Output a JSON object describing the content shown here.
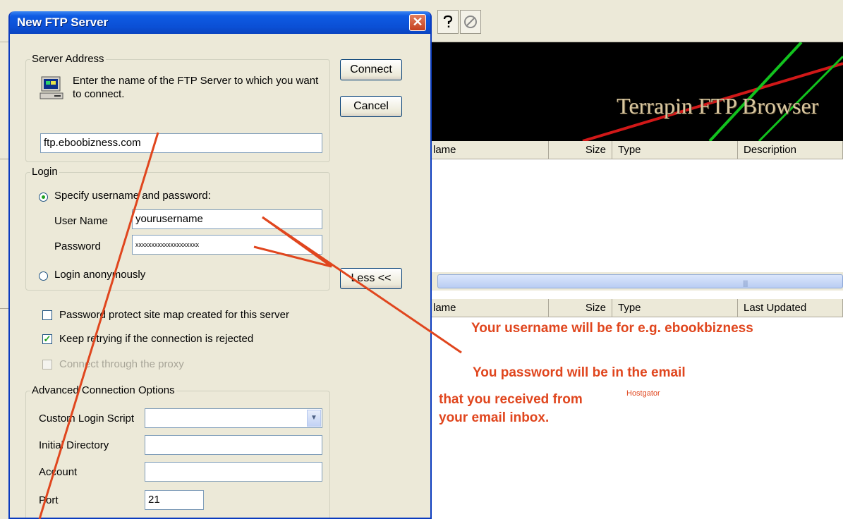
{
  "background_app": {
    "toolbar_icons": [
      "help-question-icon",
      "stop-icon"
    ],
    "banner_title": "Terrapin FTP Browser",
    "remote_list_columns": [
      "lame",
      "Size",
      "Type",
      "Description"
    ],
    "local_list_columns": [
      "lame",
      "Size",
      "Type",
      "Last Updated"
    ]
  },
  "annotations": {
    "username_note": "Your username will be for e.g. ebookbizness",
    "password_note": "You password will be in the email",
    "received_note": "that you received from",
    "hostgator_label": "Hostgator",
    "inbox_note": "your email inbox.",
    "arrow_color": "#e0461e"
  },
  "dialog": {
    "title": "New FTP Server",
    "close_glyph": "✕",
    "buttons": {
      "connect": "Connect",
      "cancel": "Cancel",
      "less": "Less <<"
    },
    "server_address": {
      "group_label": "Server Address",
      "instruction": "Enter the name of the FTP Server to which you want to connect.",
      "value": "ftp.eboobizness.com"
    },
    "login": {
      "group_label": "Login",
      "specify_label": "Specify username and password:",
      "specify_selected": true,
      "username_label": "User Name",
      "username_value": "yourusername",
      "password_label": "Password",
      "password_value": "xxxxxxxxxxxxxxxxxxxx",
      "anonymous_label": "Login anonymously"
    },
    "options": {
      "password_protect": {
        "label": "Password protect site map created for this server",
        "checked": false
      },
      "keep_retrying": {
        "label": "Keep retrying if the connection is rejected",
        "checked": true
      },
      "proxy": {
        "label": "Connect through the proxy",
        "checked": false,
        "disabled": true
      }
    },
    "advanced": {
      "group_label": "Advanced Connection Options",
      "script_label": "Custom Login Script",
      "script_value": "",
      "directory_label": "Initial Directory",
      "directory_value": "",
      "account_label": "Account",
      "account_value": "",
      "port_label": "Port",
      "port_value": "21"
    }
  }
}
